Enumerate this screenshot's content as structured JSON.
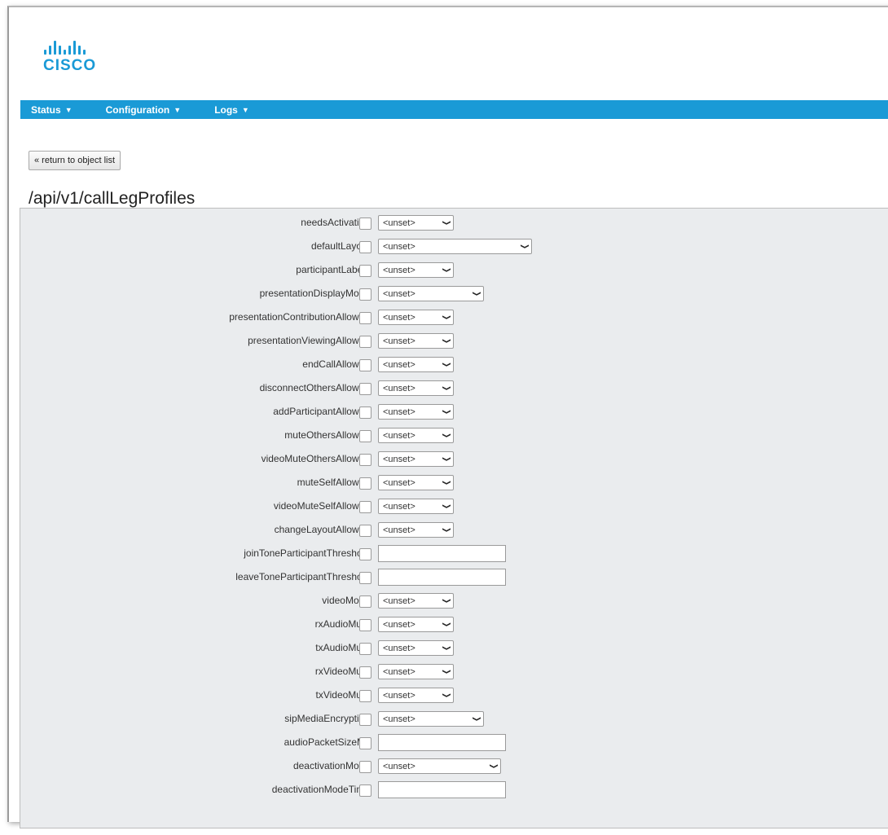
{
  "brand": {
    "logo_text": "CISCO"
  },
  "nav": {
    "items": [
      {
        "label": "Status"
      },
      {
        "label": "Configuration"
      },
      {
        "label": "Logs"
      }
    ]
  },
  "return_button": "« return to object list",
  "page_title": "/api/v1/callLegProfiles",
  "colors": {
    "accent": "#1a9ad6",
    "panel": "#eaecee"
  },
  "fields": [
    {
      "label": "needsActivation",
      "control": "select",
      "value": "<unset>",
      "width": "s"
    },
    {
      "label": "defaultLayout",
      "control": "select",
      "value": "<unset>",
      "width": "l"
    },
    {
      "label": "participantLabels",
      "control": "select",
      "value": "<unset>",
      "width": "s"
    },
    {
      "label": "presentationDisplayMode",
      "control": "select",
      "value": "<unset>",
      "width": "m"
    },
    {
      "label": "presentationContributionAllowed",
      "control": "select",
      "value": "<unset>",
      "width": "s"
    },
    {
      "label": "presentationViewingAllowed",
      "control": "select",
      "value": "<unset>",
      "width": "s"
    },
    {
      "label": "endCallAllowed",
      "control": "select",
      "value": "<unset>",
      "width": "s"
    },
    {
      "label": "disconnectOthersAllowed",
      "control": "select",
      "value": "<unset>",
      "width": "s"
    },
    {
      "label": "addParticipantAllowed",
      "control": "select",
      "value": "<unset>",
      "width": "s"
    },
    {
      "label": "muteOthersAllowed",
      "control": "select",
      "value": "<unset>",
      "width": "s"
    },
    {
      "label": "videoMuteOthersAllowed",
      "control": "select",
      "value": "<unset>",
      "width": "s"
    },
    {
      "label": "muteSelfAllowed",
      "control": "select",
      "value": "<unset>",
      "width": "s"
    },
    {
      "label": "videoMuteSelfAllowed",
      "control": "select",
      "value": "<unset>",
      "width": "s"
    },
    {
      "label": "changeLayoutAllowed",
      "control": "select",
      "value": "<unset>",
      "width": "s"
    },
    {
      "label": "joinToneParticipantThreshold",
      "control": "text",
      "value": ""
    },
    {
      "label": "leaveToneParticipantThreshold",
      "control": "text",
      "value": ""
    },
    {
      "label": "videoMode",
      "control": "select",
      "value": "<unset>",
      "width": "s"
    },
    {
      "label": "rxAudioMute",
      "control": "select",
      "value": "<unset>",
      "width": "s"
    },
    {
      "label": "txAudioMute",
      "control": "select",
      "value": "<unset>",
      "width": "s"
    },
    {
      "label": "rxVideoMute",
      "control": "select",
      "value": "<unset>",
      "width": "s"
    },
    {
      "label": "txVideoMute",
      "control": "select",
      "value": "<unset>",
      "width": "s"
    },
    {
      "label": "sipMediaEncryption",
      "control": "select",
      "value": "<unset>",
      "width": "m"
    },
    {
      "label": "audioPacketSizeMs",
      "control": "text",
      "value": ""
    },
    {
      "label": "deactivationMode",
      "control": "select",
      "value": "<unset>",
      "width": "xl"
    },
    {
      "label": "deactivationModeTime",
      "control": "text",
      "value": ""
    }
  ]
}
